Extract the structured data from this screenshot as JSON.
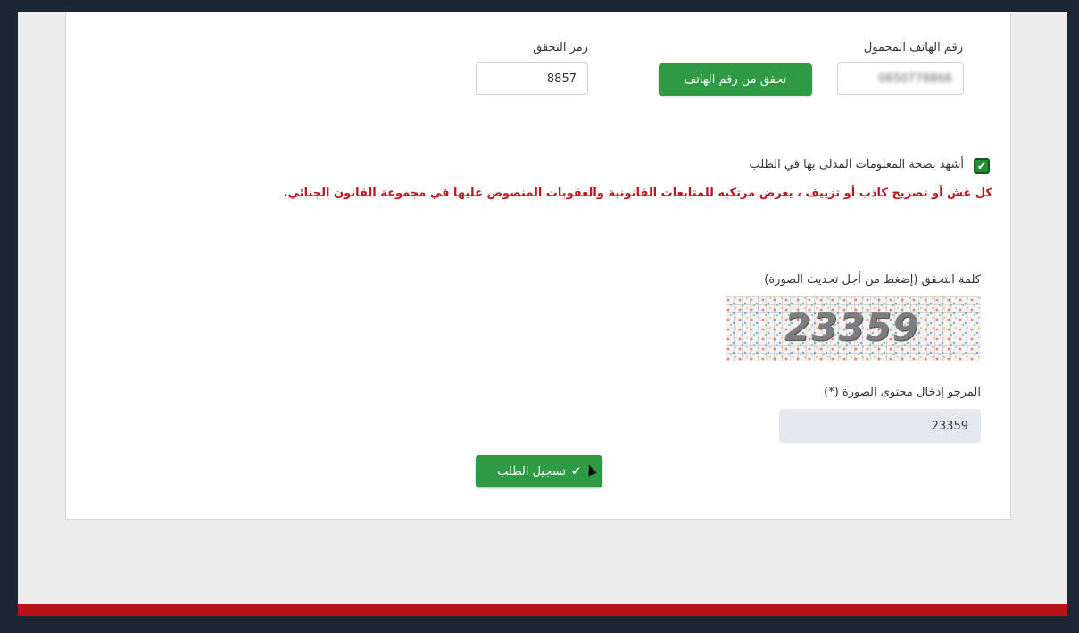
{
  "phone": {
    "label": "رقم الهاتف المحمول",
    "value": "0650778866"
  },
  "verify_phone_button": "تحقق من رقم الهاتف",
  "verification_code": {
    "label": "رمز التحقق",
    "value": "8857"
  },
  "attestation": {
    "checked": true,
    "label": "أشهد بصحة المعلومات المدلى بها في الطلب"
  },
  "warning_text": "كل غش أو تصريح كاذب أو تزييف ، يعرض مرتكبه للمتابعات القانونية والعقوبات المنصوص عليها في مجموعة القانون الجنائي.",
  "captcha": {
    "label": "كلمة التحقق (إضغط من أجل تحديث الصورة)",
    "image_text": "23359",
    "input_label": "المرجو إدخال محتوى الصورة (*)",
    "input_value": "23359"
  },
  "submit_button": "تسجيل الطلب",
  "colors": {
    "accent_green": "#2e9a43",
    "warning_red": "#c0141f",
    "bottom_bar": "#b8121a"
  }
}
